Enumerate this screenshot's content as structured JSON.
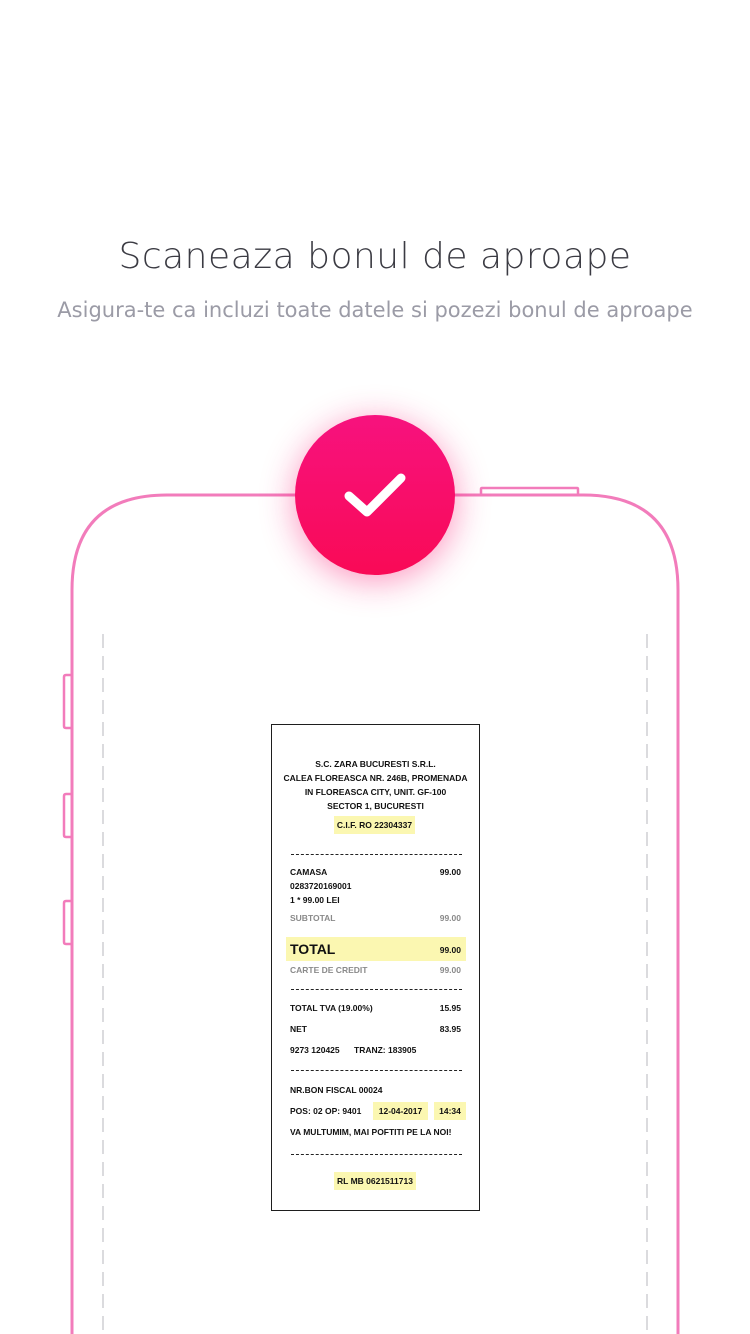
{
  "header": {
    "title": "Scaneaza bonul de aproape",
    "subtitle": "Asigura-te ca incluzi toate datele si pozezi bonul de aproape"
  },
  "colors": {
    "accent": "#f7127e",
    "phone_outline": "#f27cbb",
    "highlight": "#fbf7b1"
  },
  "icons": {
    "check": "check-icon"
  },
  "receipt": {
    "company": "S.C. ZARA BUCURESTI S.R.L.",
    "address1": "CALEA FLOREASCA NR. 246B, PROMENADA",
    "address2": "IN FLOREASCA CITY, UNIT. GF-100",
    "address3": "SECTOR 1, BUCURESTI",
    "cif": "C.I.F. RO 22304337",
    "item_name": "CAMASA",
    "item_price": "99.00",
    "item_code": "0283720169001",
    "item_qty": "1 * 99.00 LEI",
    "subtotal_label": "SUBTOTAL",
    "subtotal_value": "99.00",
    "total_label": "TOTAL",
    "total_value": "99.00",
    "card_label": "CARTE DE CREDIT",
    "card_value": "99.00",
    "tva_label": "TOTAL TVA (19.00%)",
    "tva_value": "15.95",
    "net_label": "NET",
    "net_value": "83.95",
    "terminal": "9273 120425",
    "tranz": "TRANZ: 183905",
    "bon_fiscal": "NR.BON FISCAL 00024",
    "pos": "POS: 02 OP: 9401",
    "date": "12-04-2017",
    "time": "14:34",
    "thanks": "VA MULTUMIM, MAI POFTITI PE LA NOI!",
    "footer_code": "RL MB 0621511713"
  }
}
